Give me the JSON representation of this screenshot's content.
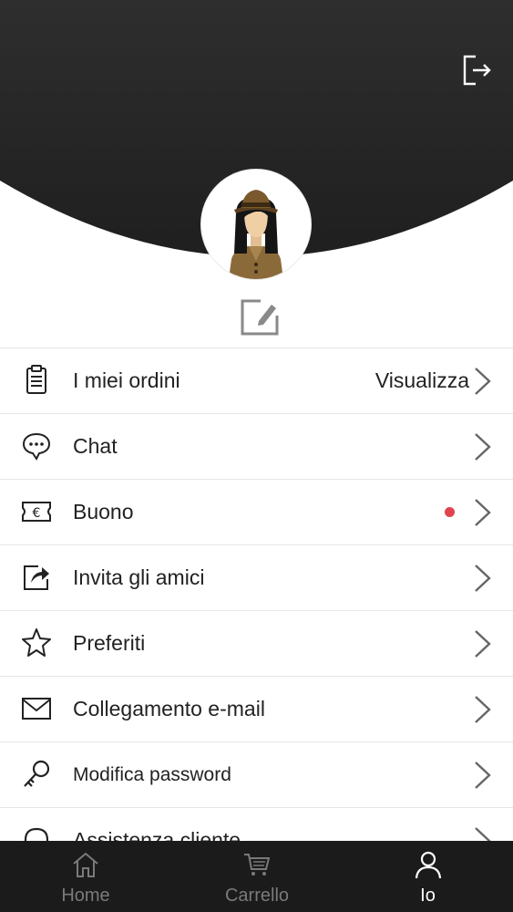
{
  "header": {
    "logout_icon": "logout-icon",
    "background": "#2a2a2a"
  },
  "profile": {
    "avatar_icon": "avatar-woman-hat",
    "edit_icon": "edit-icon"
  },
  "menu": {
    "items": [
      {
        "label": "I miei ordini",
        "value": "Visualizza",
        "icon": "clipboard-icon"
      },
      {
        "label": "Chat",
        "icon": "chat-bubble-icon"
      },
      {
        "label": "Buono",
        "icon": "voucher-euro-icon",
        "badge_color": "#e0454f"
      },
      {
        "label": "Invita gli amici",
        "icon": "share-icon"
      },
      {
        "label": "Preferiti",
        "icon": "star-icon"
      },
      {
        "label": "Collegamento e-mail",
        "icon": "envelope-icon"
      },
      {
        "label": "Modifica password",
        "icon": "key-icon"
      },
      {
        "label": "Assistenza cliente",
        "icon": "headset-icon"
      }
    ]
  },
  "tabbar": {
    "background": "#1b1b1b",
    "active_color": "#ffffff",
    "inactive_color": "#7a7a7a",
    "tabs": [
      {
        "label": "Home",
        "icon": "home-icon",
        "active": false
      },
      {
        "label": "Carrello",
        "icon": "cart-icon",
        "active": false
      },
      {
        "label": "Io",
        "icon": "user-icon",
        "active": true
      }
    ]
  }
}
